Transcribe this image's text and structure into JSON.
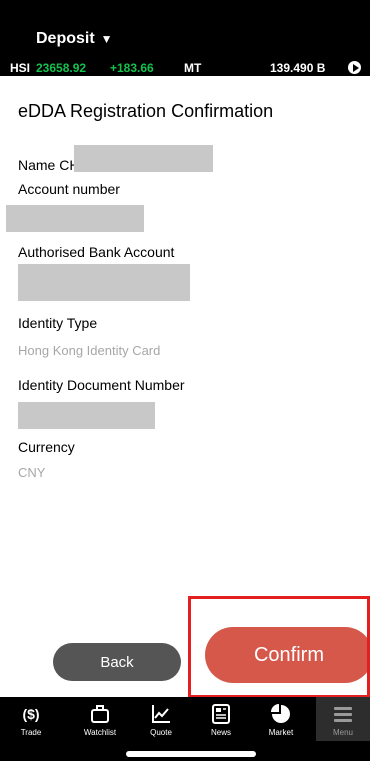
{
  "header": {
    "title": "Deposit",
    "title_caret": "▼",
    "ticker": {
      "index_name": "HSI",
      "index_value": "23658.92",
      "change": "+183.66",
      "session": "MT",
      "turnover": "139.490 B"
    }
  },
  "page": {
    "title": "eDDA Registration Confirmation",
    "name_label": "Name",
    "name_value_visible": "CH",
    "account_number_label": "Account number",
    "authorised_bank_label": "Authorised Bank Account",
    "identity_type_label": "Identity Type",
    "identity_type_value": "Hong Kong Identity Card",
    "identity_doc_label": "Identity Document Number",
    "currency_label": "Currency",
    "currency_value": "CNY"
  },
  "actions": {
    "back_label": "Back",
    "confirm_label": "Confirm"
  },
  "tabs": [
    {
      "label": "Trade",
      "icon": "dollar-icon"
    },
    {
      "label": "Watchlist",
      "icon": "briefcase-icon"
    },
    {
      "label": "Quote",
      "icon": "line-chart-icon"
    },
    {
      "label": "News",
      "icon": "newspaper-icon"
    },
    {
      "label": "Market",
      "icon": "pie-chart-icon"
    },
    {
      "label": "Menu",
      "icon": "hamburger-menu-icon",
      "active": true
    }
  ],
  "colors": {
    "up_green": "#12c24d",
    "confirm_red": "#d5584b",
    "highlight_red": "#e41f1f"
  }
}
